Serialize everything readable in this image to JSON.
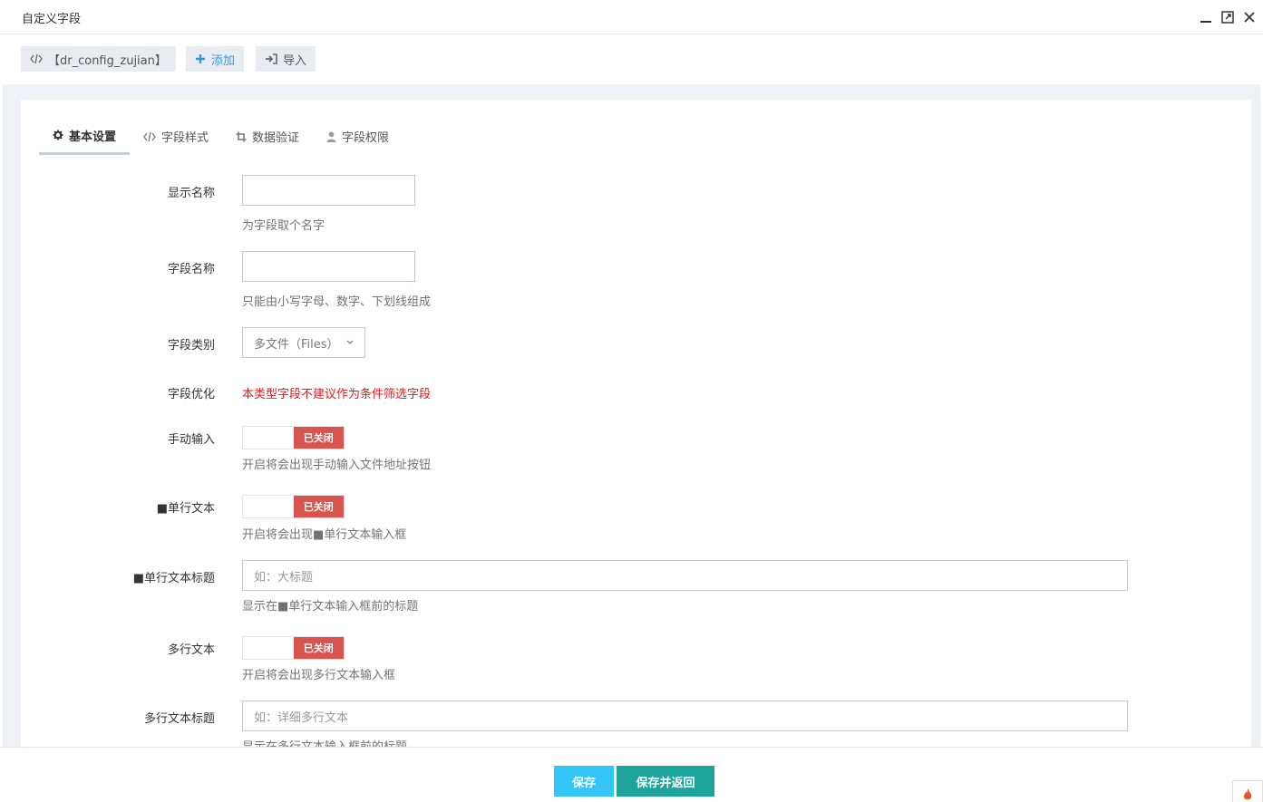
{
  "window": {
    "title": "自定义字段"
  },
  "toolbar": {
    "code_label": "【dr_config_zujian】",
    "add_label": "添加",
    "import_label": "导入"
  },
  "tabs": [
    {
      "label": "基本设置",
      "icon": "gear-icon",
      "active": true
    },
    {
      "label": "字段样式",
      "icon": "code-icon",
      "active": false
    },
    {
      "label": "数据验证",
      "icon": "crop-icon",
      "active": false
    },
    {
      "label": "字段权限",
      "icon": "user-icon",
      "active": false
    }
  ],
  "form": {
    "display_name": {
      "label": "显示名称",
      "value": "",
      "help": "为字段取个名字"
    },
    "field_name": {
      "label": "字段名称",
      "value": "",
      "help": "只能由小写字母、数字、下划线组成"
    },
    "field_type": {
      "label": "字段类别",
      "selected": "多文件（Files）"
    },
    "field_optimize": {
      "label": "字段优化",
      "warning": "本类型字段不建议作为条件筛选字段"
    },
    "manual_input": {
      "label": "手动输入",
      "state": "已关闭",
      "help": "开启将会出现手动输入文件地址按钮"
    },
    "single_text": {
      "label": "■单行文本",
      "state": "已关闭",
      "help": "开启将会出现■单行文本输入框"
    },
    "single_text_title": {
      "label": "■单行文本标题",
      "placeholder": "如：大标题",
      "help": "显示在■单行文本输入框前的标题"
    },
    "multi_text": {
      "label": "多行文本",
      "state": "已关闭",
      "help": "开启将会出现多行文本输入框"
    },
    "multi_text_title": {
      "label": "多行文本标题",
      "placeholder": "如：详细多行文本",
      "help": "显示在多行文本输入框前的标题"
    }
  },
  "footer": {
    "save_label": "保存",
    "save_back_label": "保存并返回"
  },
  "colors": {
    "off_switch": "#d9534f",
    "save": "#32c5f6",
    "save_back": "#1ba39c",
    "warning": "#e7191b",
    "add_link": "#3598dc"
  }
}
